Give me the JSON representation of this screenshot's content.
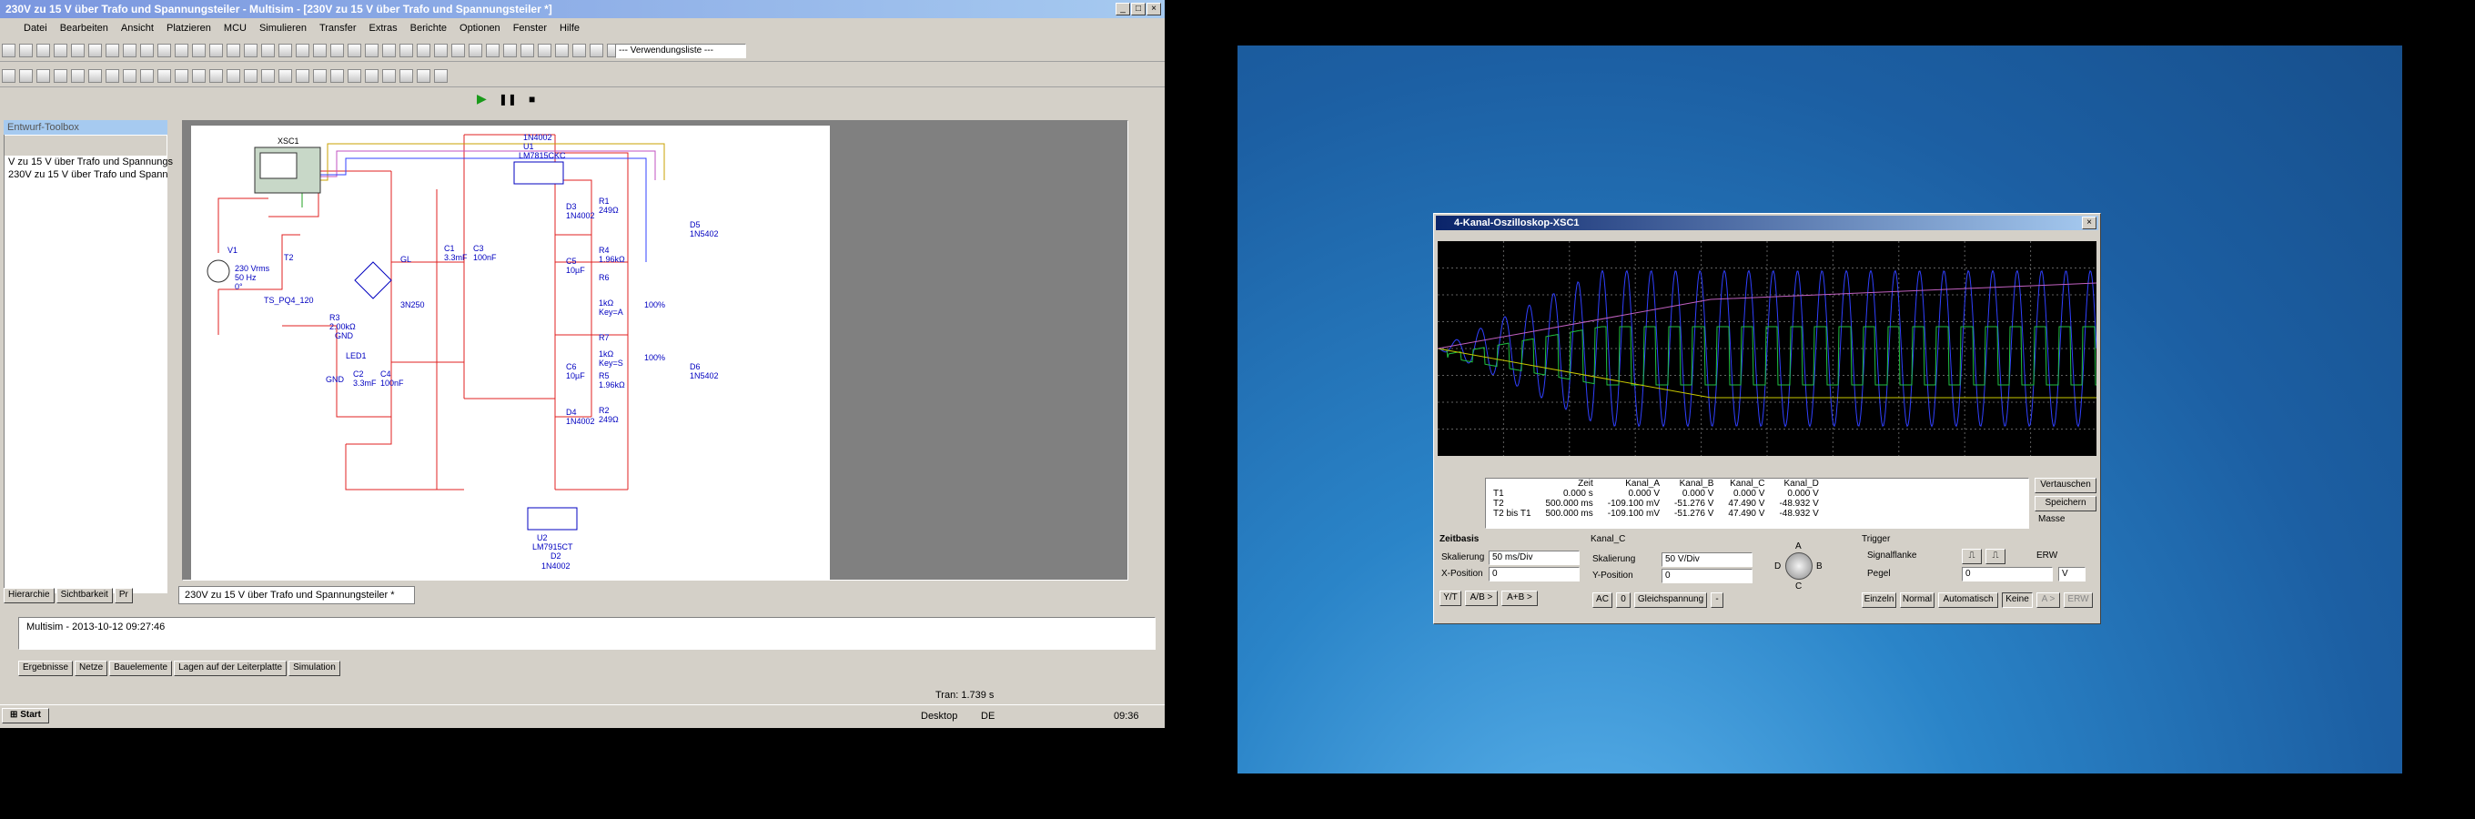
{
  "multisim": {
    "title": "230V zu 15 V über Trafo und Spannungsteiler - Multisim - [230V zu 15 V über Trafo und Spannungsteiler *]",
    "menu": [
      "Datei",
      "Bearbeiten",
      "Ansicht",
      "Platzieren",
      "MCU",
      "Simulieren",
      "Transfer",
      "Extras",
      "Berichte",
      "Optionen",
      "Fenster",
      "Hilfe"
    ],
    "usage_list": "--- Verwendungsliste ---",
    "toolbox_title": "Entwurf-Toolbox",
    "toolbox_items": [
      "V zu 15 V über Trafo und Spannungs",
      "230V zu 15 V über Trafo und Spann"
    ],
    "toolbox_tabs": [
      "Hierarchie",
      "Sichtbarkeit",
      "Pr"
    ],
    "sheet_tab": "230V zu 15 V über Trafo und Spannungsteiler *",
    "log_line": "Multisim  -  2013-10-12 09:27:46",
    "bottom_tabs": [
      "Ergebnisse",
      "Netze",
      "Bauelemente",
      "Lagen auf der Leiterplatte",
      "Simulation"
    ],
    "status_tran": "Tran: 1.739 s",
    "schematic_labels": {
      "xsc": "XSC1",
      "v1": "V1",
      "v1_val": "230 Vrms",
      "v1_freq": "50 Hz",
      "v1_phase": "0°",
      "t2": "T2",
      "t2_model": "TS_PQ4_120",
      "gl": "GL",
      "bridge": "3N250",
      "c1": "C1",
      "c1_val": "3.3mF",
      "c3": "C3",
      "c3_val": "100nF",
      "d1n": "1N4002",
      "u1": "U1",
      "u1_model": "LM7815CKC",
      "d3": "D3",
      "d3_val": "1N4002",
      "r1": "R1",
      "r1_val": "249Ω",
      "d5": "D5",
      "d5_val": "1N5402",
      "r4": "R4",
      "r4_val": "1.96kΩ",
      "c5": "C5",
      "c5_val": "10µF",
      "r6": "R6",
      "r6_val": "1kΩ",
      "r6_key": "Key=A",
      "r6_pct": "100%",
      "r3": "R3",
      "r3_val": "2.00kΩ",
      "gnd1": "GND",
      "led": "LED1",
      "r7": "R7",
      "r7_val": "1kΩ",
      "r7_key": "Key=S",
      "r7_pct": "100%",
      "c2": "C2",
      "c2_val": "3.3mF",
      "c4": "C4",
      "c4_val": "100nF",
      "gnd2": "GND",
      "c6": "C6",
      "c6_val": "10µF",
      "d6": "D6",
      "d6_val": "1N5402",
      "r5": "R5",
      "r5_val": "1.96kΩ",
      "r2": "R2",
      "r2_val": "249Ω",
      "d4": "D4",
      "d4_val": "1N4002",
      "u2": "U2",
      "u2_model": "LM7915CT",
      "d2": "D2",
      "d2_val": "1N4002"
    },
    "taskbar": {
      "start": "Start",
      "desktop": "Desktop",
      "lang": "DE",
      "clock": "09:36"
    }
  },
  "oscilloscope": {
    "title": "4-Kanal-Oszilloskop-XSC1",
    "table_headers": [
      "",
      "Zeit",
      "Kanal_A",
      "Kanal_B",
      "Kanal_C",
      "Kanal_D"
    ],
    "rows": [
      [
        "T1",
        "0.000 s",
        "0.000 V",
        "0.000 V",
        "0.000 V",
        "0.000 V"
      ],
      [
        "T2",
        "500.000 ms",
        "-109.100 mV",
        "-51.276 V",
        "47.490 V",
        "-48.932 V"
      ],
      [
        "T2 bis T1",
        "500.000 ms",
        "-109.100 mV",
        "-51.276 V",
        "47.490 V",
        "-48.932 V"
      ]
    ],
    "btn_swap": "Vertauschen",
    "btn_save": "Speichern",
    "ground": "Masse",
    "zeitbasis": "Zeitbasis",
    "skalierung": "Skalierung",
    "zeit_scale": "50 ms/Div",
    "x_pos_label": "X-Position",
    "x_pos": "0",
    "mode_buttons": [
      "Y/T",
      "A/B >",
      "A+B >"
    ],
    "kanal": "Kanal_C",
    "kanal_scale": "50  V/Div",
    "y_pos_label": "Y-Position",
    "y_pos": "0",
    "coupling": [
      "AC",
      "0",
      "Gleichspannung",
      "-"
    ],
    "knob_labels": {
      "a": "A",
      "b": "B",
      "c": "C",
      "d": "D"
    },
    "trigger": "Trigger",
    "signalflanke": "Signalflanke",
    "erw": "ERW",
    "pegel": "Pegel",
    "pegel_val": "0",
    "pegel_unit": "V",
    "trigger_buttons": [
      "Einzeln",
      "Normal",
      "Automatisch",
      "Keine",
      "A >",
      "ERW"
    ]
  },
  "colors": {
    "trace_blue": "#3040ff",
    "trace_green": "#20c040",
    "trace_yellow": "#c8c800",
    "trace_pink": "#c060c0",
    "wire_red": "#e02020"
  }
}
